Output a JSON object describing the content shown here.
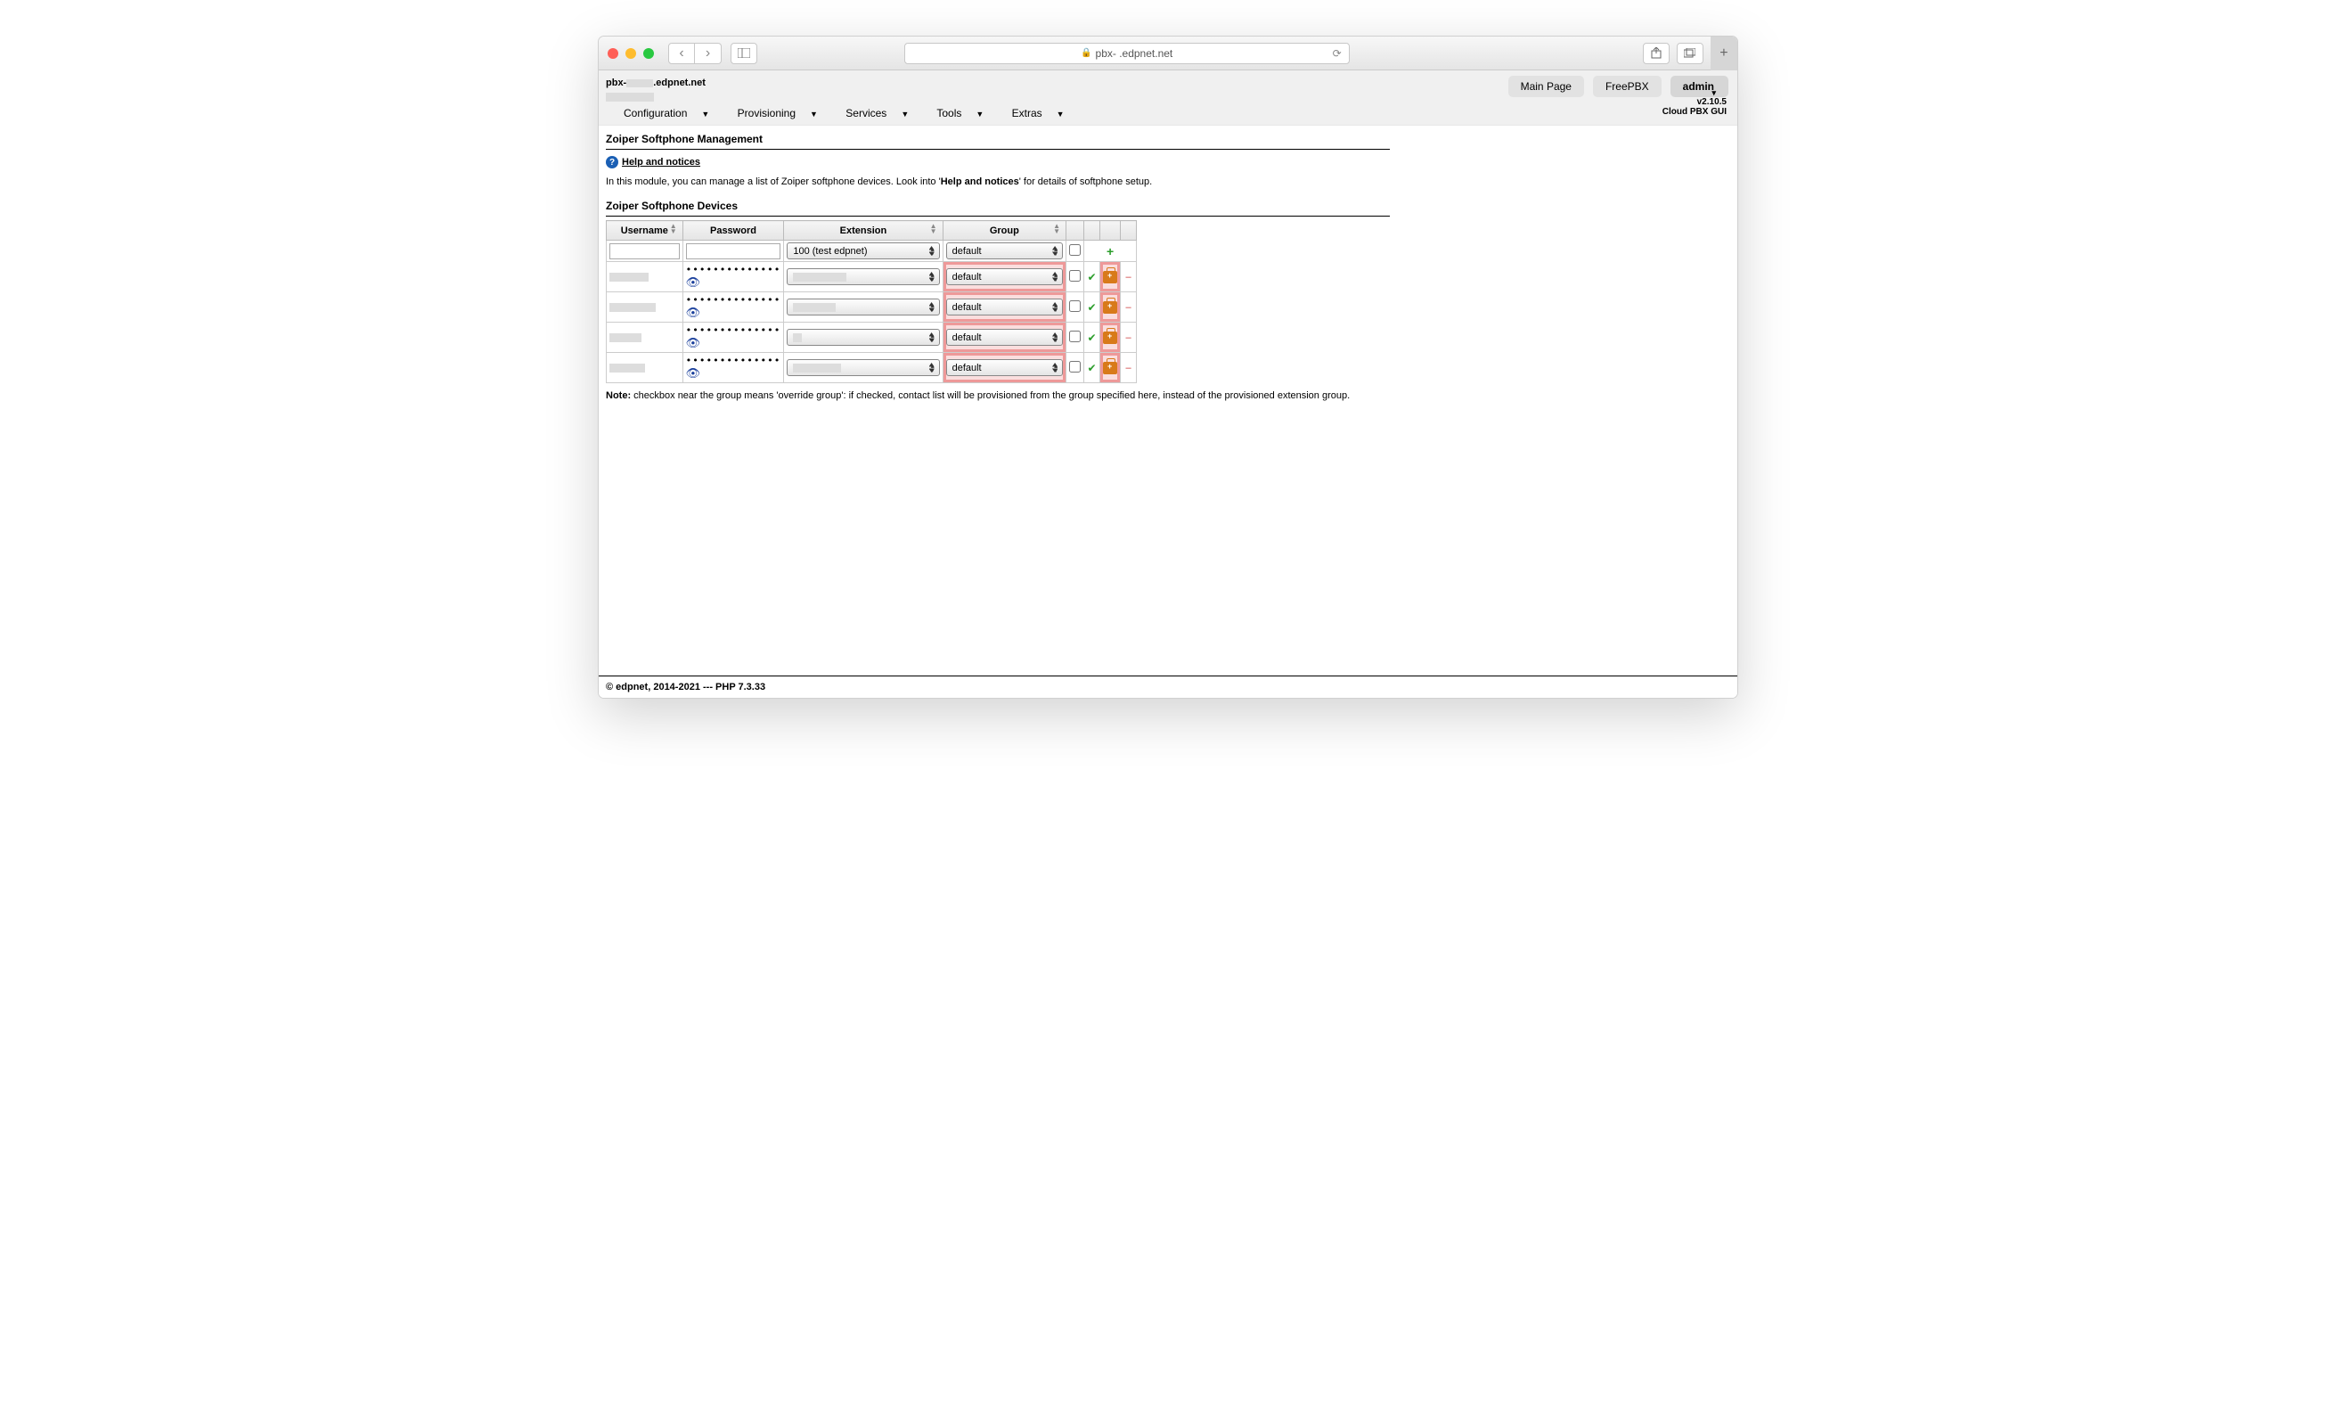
{
  "browser": {
    "url_display": "pbx-        .edpnet.net",
    "host_tab": "pbx-        .edpnet.net"
  },
  "header": {
    "buttons": {
      "main": "Main Page",
      "freepbx": "FreePBX",
      "admin": "admin"
    },
    "version_line1": "v2.10.5",
    "version_line2": "Cloud PBX GUI"
  },
  "menu": {
    "items": [
      "Configuration",
      "Provisioning",
      "Services",
      "Tools",
      "Extras"
    ]
  },
  "page": {
    "title": "Zoiper Softphone Management",
    "help_label": "Help and notices",
    "desc_pre": "In this module, you can manage a list of Zoiper softphone devices. Look into '",
    "desc_bold": "Help and notices",
    "desc_post": "' for details of softphone setup.",
    "table_title": "Zoiper Softphone Devices",
    "columns": {
      "user": "Username",
      "pass": "Password",
      "ext": "Extension",
      "grp": "Group"
    },
    "new_row": {
      "ext_selected": "100 (test edpnet)",
      "grp_selected": "default"
    },
    "rows": [
      {
        "user_redact_w": 44,
        "pass": "••••••••••••••",
        "ext_redact_w": 60,
        "grp": "default"
      },
      {
        "user_redact_w": 52,
        "pass": "••••••••••••••",
        "ext_redact_w": 48,
        "grp": "default"
      },
      {
        "user_redact_w": 36,
        "pass": "••••••••••••••",
        "ext_redact_w": 10,
        "grp": "default"
      },
      {
        "user_redact_w": 40,
        "pass": "••••••••••••••",
        "ext_redact_w": 54,
        "grp": "default"
      }
    ],
    "note_label": "Note:",
    "note_text": " checkbox near the group means 'override group': if checked, contact list will be provisioned from the group specified here, instead of the provisioned extension group."
  },
  "footer": "© edpnet, 2014-2021 --- PHP 7.3.33"
}
